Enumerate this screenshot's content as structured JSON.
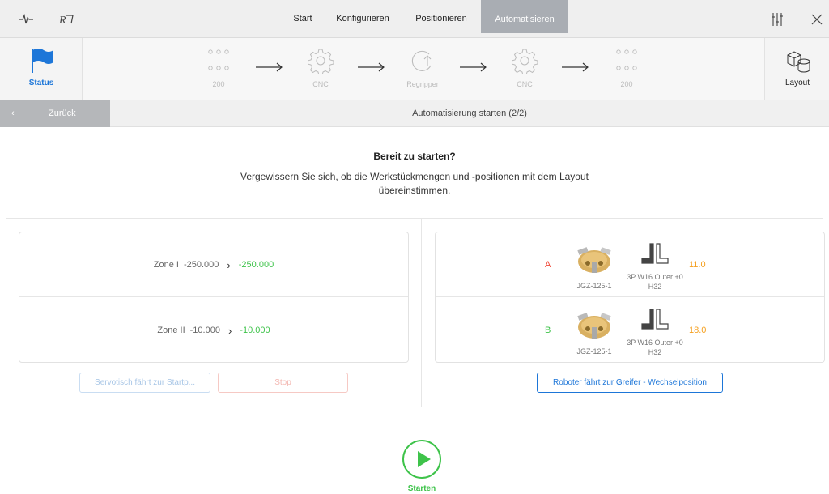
{
  "topbar": {
    "tabs": [
      "Start",
      "Konfigurieren",
      "Positionieren",
      "Automatisieren"
    ],
    "active_tab": "Automatisieren"
  },
  "flow": {
    "status_label": "Status",
    "layout_label": "Layout",
    "steps": [
      {
        "label": "200",
        "icon": "dots-grid-icon"
      },
      {
        "label": "CNC",
        "icon": "gear-icon"
      },
      {
        "label": "Regripper",
        "icon": "regrip-arrow-icon"
      },
      {
        "label": "CNC",
        "icon": "gear-icon"
      },
      {
        "label": "200",
        "icon": "dots-grid-icon"
      }
    ]
  },
  "backbar": {
    "back_label": "Zurück",
    "title": "Automatisierung starten (2/2)"
  },
  "ready": {
    "title": "Bereit zu starten?",
    "text": "Vergewissern Sie sich, ob die Werkstückmengen und -positionen mit dem Layout übereinstimmen."
  },
  "zones": [
    {
      "name": "Zone I",
      "current": "-250.000",
      "target": "-250.000"
    },
    {
      "name": "Zone II",
      "current": "-10.000",
      "target": "-10.000"
    }
  ],
  "buttons": {
    "servo_label": "Servotisch fährt zur Startp...",
    "stop_label": "Stop",
    "robot_label": "Roboter fährt zur Greifer - Wechselposition",
    "start_label": "Starten"
  },
  "grippers": [
    {
      "letter": "A",
      "letter_color": "#f04a3a",
      "name": "JGZ-125-1",
      "desc_line1": "3P W16 Outer +0",
      "desc_line2": "H32",
      "value": "11.0"
    },
    {
      "letter": "B",
      "letter_color": "#3ec34a",
      "name": "JGZ-125-1",
      "desc_line1": "3P W16 Outer +0",
      "desc_line2": "H32",
      "value": "18.0"
    }
  ],
  "colors": {
    "accent_blue": "#1d76d8",
    "green": "#3ec34a",
    "orange": "#f5a020",
    "red": "#f04a3a"
  }
}
